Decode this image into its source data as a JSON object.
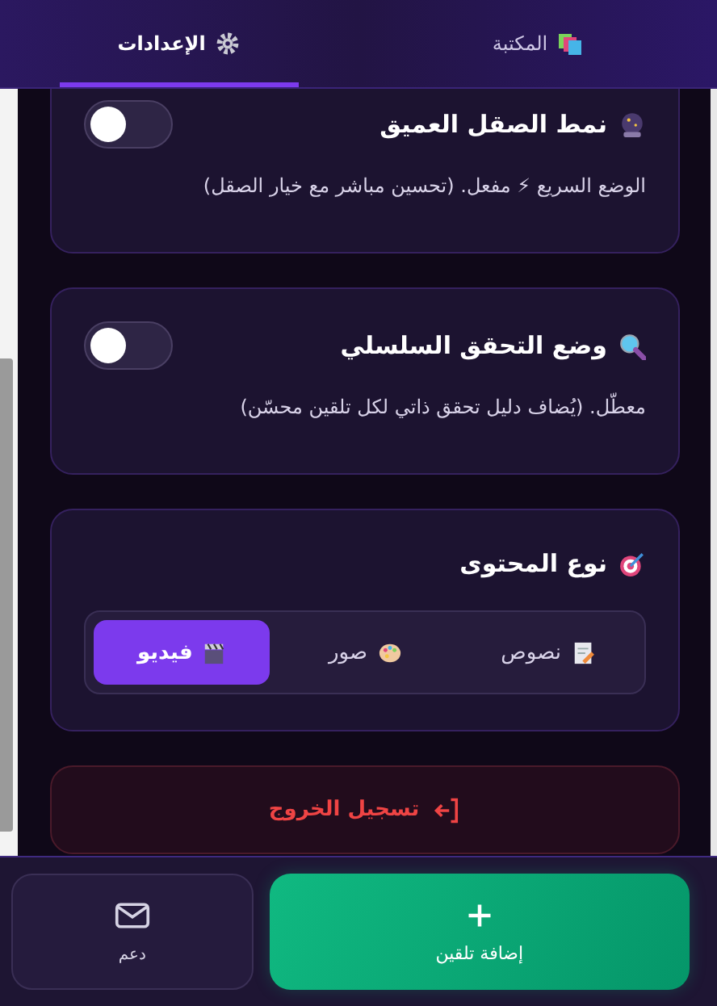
{
  "tabs": [
    {
      "label": "المكتبة",
      "selected": false
    },
    {
      "label": "الإعدادات",
      "selected": true
    }
  ],
  "settings": [
    {
      "title": "نمط الصقل العميق",
      "description": "الوضع السريع ⚡ مفعل. (تحسين مباشر مع خيار الصقل)",
      "on": false
    },
    {
      "title": "وضع التحقق السلسلي",
      "description": "معطّل. (يُضاف دليل تحقق ذاتي لكل تلقين محسّن)",
      "on": false
    }
  ],
  "content_type": {
    "title": "نوع المحتوى",
    "options": [
      {
        "label": "نصوص",
        "selected": false
      },
      {
        "label": "صور",
        "selected": false
      },
      {
        "label": "فيديو",
        "selected": true
      }
    ]
  },
  "logout": {
    "label": "تسجيل الخروج"
  },
  "bottom_bar": {
    "add_button": "إضافة تلقين",
    "support_button": "دعم"
  }
}
